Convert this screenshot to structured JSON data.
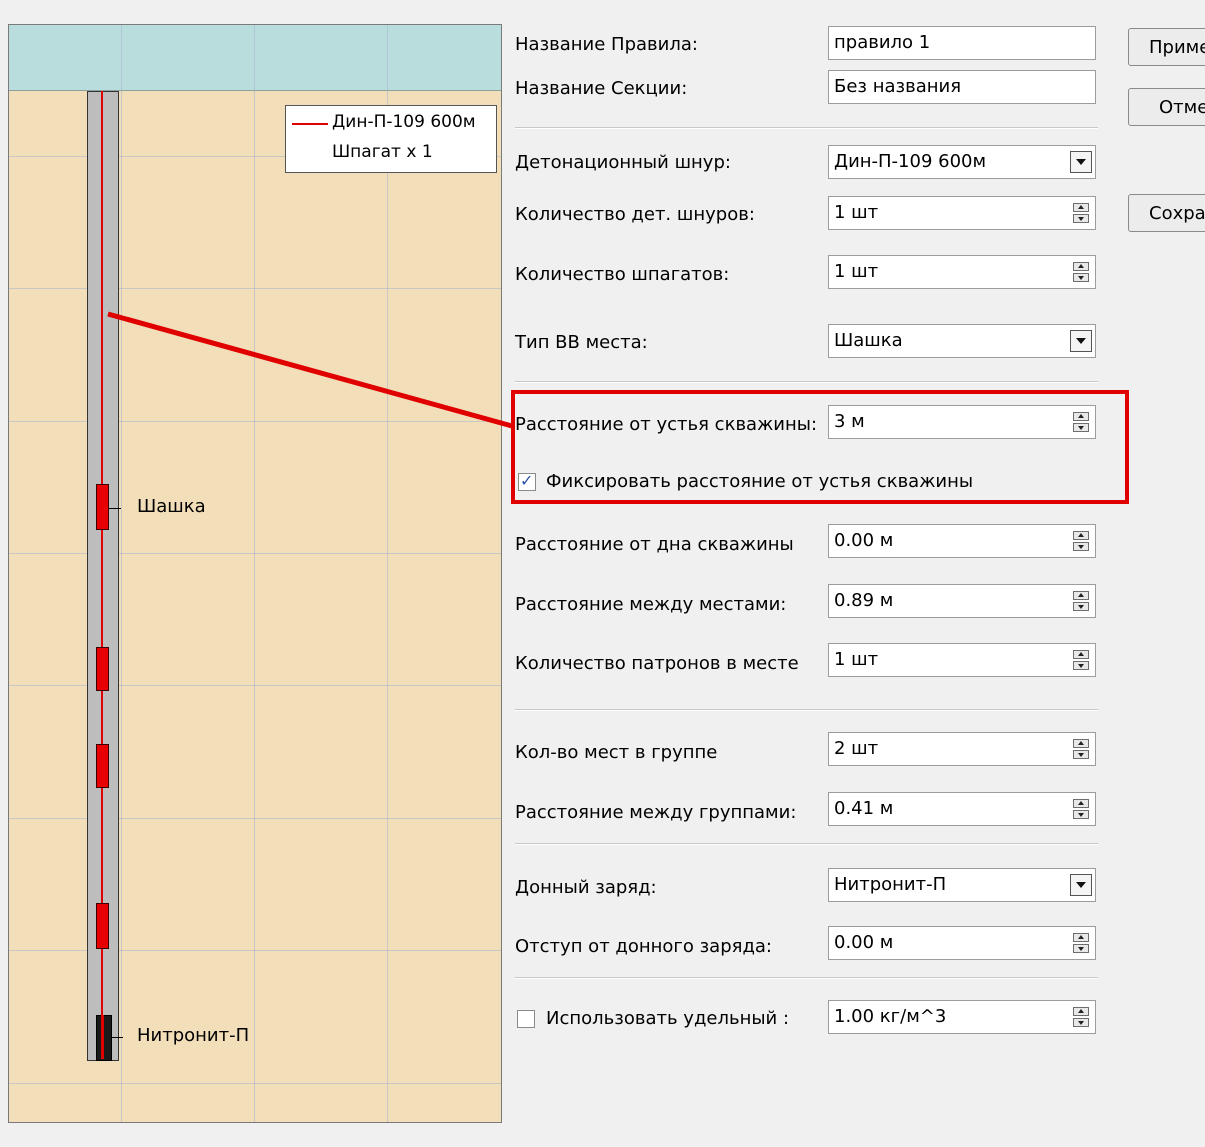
{
  "diagram": {
    "legend": {
      "cord": "Дин-П-109 600м",
      "twine": "Шпагат x 1"
    },
    "charge_label": "Шашка",
    "bottom_charge_label": "Нитронит-П"
  },
  "form": {
    "rule_name_label": "Название Правила:",
    "rule_name_value": "правило 1",
    "section_name_label": "Название Секции:",
    "section_name_value": "Без названия",
    "det_cord_label": "Детонационный шнур:",
    "det_cord_value": "Дин-П-109 600м",
    "det_cord_count_label": "Количество дет. шнуров:",
    "det_cord_count_value": "1 шт",
    "twine_count_label": "Количество шпагатов:",
    "twine_count_value": "1 шт",
    "explosive_type_label": "Тип ВВ места:",
    "explosive_type_value": "Шашка",
    "dist_from_mouth_label": "Расстояние от устья скважины:",
    "dist_from_mouth_value": "3 м",
    "fix_distance_label": "Фиксировать расстояние от устья скважины",
    "fix_distance_checked": true,
    "dist_from_bottom_label": "Расстояние от дна скважины",
    "dist_from_bottom_value": "0.00 м",
    "dist_between_places_label": "Расстояние между местами:",
    "dist_between_places_value": "0.89 м",
    "cartridges_label": "Количество патронов в месте",
    "cartridges_value": "1 шт",
    "places_in_group_label": "Кол-во мест в группе",
    "places_in_group_value": "2 шт",
    "dist_between_groups_label": "Расстояние между группами:",
    "dist_between_groups_value": "0.41 м",
    "bottom_charge_label": "Донный заряд:",
    "bottom_charge_value": "Нитронит-П",
    "bottom_offset_label": "Отступ от донного заряда:",
    "bottom_offset_value": "0.00 м",
    "use_specific_label": "Использовать удельный :",
    "use_specific_checked": false,
    "use_specific_value": "1.00 кг/м^3"
  },
  "buttons": {
    "apply": "Приме",
    "cancel": "Отме",
    "save": "Сохра"
  },
  "colors": {
    "highlight": "#e00000",
    "diagram_bg": "#f2deb9",
    "diagram_header": "#b9dcdc",
    "charge": "#e80000"
  }
}
